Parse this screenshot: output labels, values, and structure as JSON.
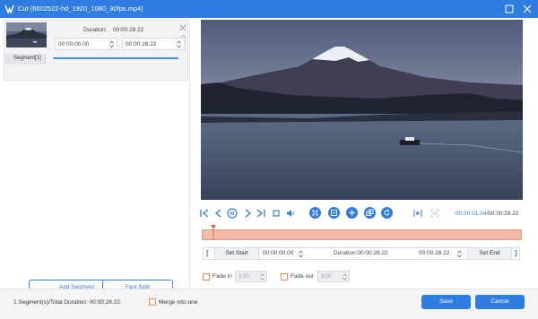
{
  "window": {
    "title": "Cut (6602522-hd_1920_1080_30fps.mp4)"
  },
  "segment": {
    "duration_label": "Duration:",
    "duration_value": "00:00:28.22",
    "start_time": "00:00:00.00",
    "end_time": "00:00:28.22",
    "tag": "Segment[1]"
  },
  "left_actions": {
    "add_segment": "Add Segment",
    "fast_split": "Fast Split"
  },
  "player": {
    "current_time": "00:00:01.04",
    "separator": "/",
    "total_time": "00:00:28.22",
    "progress": 0.037
  },
  "trim": {
    "set_start": "Set Start",
    "set_end": "Set End",
    "start_value": "00:00:00.00",
    "duration_text": "Duration:00:00:28.22",
    "end_value": "00:00:28.22",
    "bracket_left": "[",
    "bracket_right": "]"
  },
  "fade": {
    "fade_in_label": "Fade in",
    "fade_in_value": "3.00",
    "fade_out_label": "Fade out",
    "fade_out_value": "3.00"
  },
  "footer": {
    "status": "1 Segment(s)/Total Duration: 00:00:28.22",
    "merge_label": "Merge into one",
    "save": "Save",
    "cancel": "Cancel"
  },
  "colors": {
    "accent": "#2f7de1",
    "timeline_fill": "#f3b9a9",
    "checkbox_border": "#f08a5d"
  },
  "icons": [
    "app-logo-icon",
    "maximize-icon",
    "close-icon",
    "skip-start-icon",
    "prev-frame-icon",
    "pause-icon",
    "next-frame-icon",
    "skip-end-icon",
    "stop-icon",
    "volume-icon",
    "trim-icon",
    "copy-icon",
    "add-icon",
    "duplicate-icon",
    "rotate-icon",
    "jump-start-icon",
    "fullscreen-icon"
  ]
}
